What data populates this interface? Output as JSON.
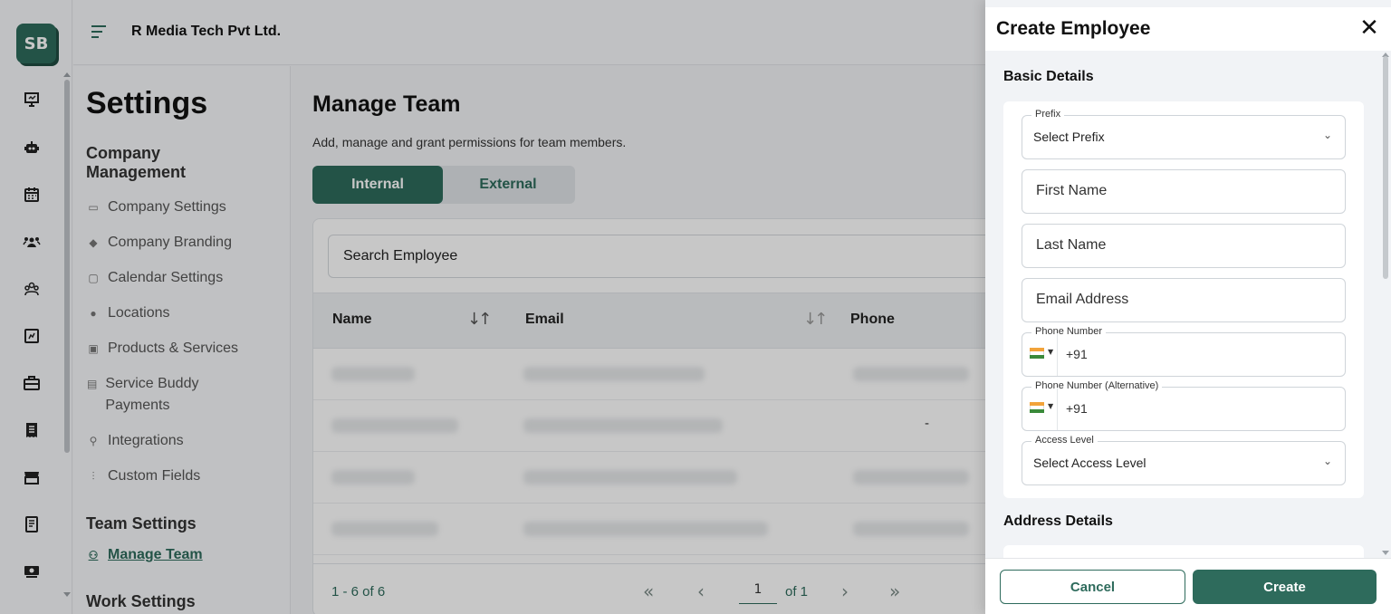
{
  "app": {
    "logo_text": "SB",
    "company_name": "R Media Tech Pvt Ltd."
  },
  "rail_icons": [
    "presentation-icon",
    "robot-icon",
    "calendar-icon",
    "group-icon",
    "team-icon",
    "chart-icon",
    "briefcase-icon",
    "receipt-icon",
    "store-icon",
    "report-icon",
    "payment-icon"
  ],
  "settings": {
    "title": "Settings",
    "company_heading": "Company Management",
    "company_items": [
      {
        "label": "Company Settings",
        "icon": "monitor-icon"
      },
      {
        "label": "Company Branding",
        "icon": "brush-icon"
      },
      {
        "label": "Calendar Settings",
        "icon": "calendar-icon"
      },
      {
        "label": "Locations",
        "icon": "pin-icon"
      },
      {
        "label": "Products & Services",
        "icon": "box-icon"
      },
      {
        "label": "Service Buddy Payments",
        "icon": "money-icon"
      },
      {
        "label": "Integrations",
        "icon": "plug-icon"
      },
      {
        "label": "Custom Fields",
        "icon": "sliders-icon"
      }
    ],
    "team_heading": "Team Settings",
    "team_items": [
      {
        "label": "Manage Team",
        "icon": "people-icon",
        "active": true
      }
    ],
    "work_heading": "Work Settings"
  },
  "main": {
    "title": "Manage Team",
    "subtitle": "Add, manage and grant permissions for team members.",
    "tabs": [
      {
        "label": "Internal",
        "active": true
      },
      {
        "label": "External",
        "active": false
      }
    ],
    "search_placeholder": "Search Employee",
    "columns": [
      "Name",
      "Email",
      "Phone"
    ],
    "rows": [
      {
        "phone": ""
      },
      {
        "phone": "-"
      },
      {
        "phone": ""
      },
      {
        "phone": ""
      }
    ],
    "pagination": {
      "range": "1 - 6 of 6",
      "page": "1",
      "of": "of 1"
    }
  },
  "drawer": {
    "title": "Create Employee",
    "basic_heading": "Basic Details",
    "prefix": {
      "label": "Prefix",
      "value": "Select Prefix"
    },
    "first_name": "First Name",
    "last_name": "Last Name",
    "email": "Email Address",
    "phone": {
      "label": "Phone Number",
      "dial": "+91"
    },
    "phone_alt": {
      "label": "Phone Number (Alternative)",
      "dial": "+91"
    },
    "access": {
      "label": "Access Level",
      "value": "Select Access Level"
    },
    "address_heading": "Address Details",
    "cancel": "Cancel",
    "create": "Create"
  },
  "colors": {
    "brand": "#2e6b5c"
  }
}
